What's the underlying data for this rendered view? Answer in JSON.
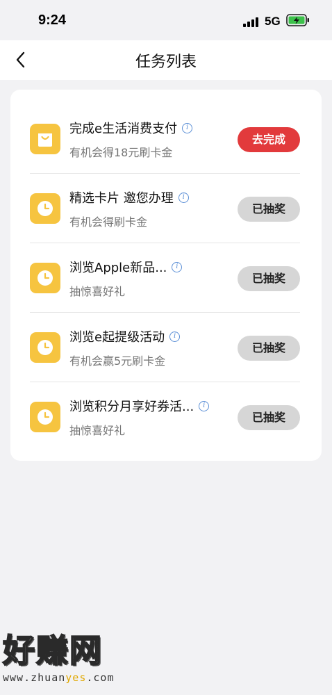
{
  "status_bar": {
    "time": "9:24",
    "network": "5G",
    "signal_icon": "cellular-signal-icon",
    "battery_icon": "battery-charging-icon"
  },
  "nav": {
    "back_icon": "chevron-left-icon",
    "title": "任务列表"
  },
  "tasks": [
    {
      "title": "完成e生活消费支付",
      "subtitle": "有机会得18元刷卡金",
      "button": "去完成",
      "icon": "shopping-bag-icon",
      "state": "active"
    },
    {
      "title": "精选卡片 邀您办理",
      "subtitle": "有机会得刷卡金",
      "button": "已抽奖",
      "icon": "clock-icon",
      "state": "done"
    },
    {
      "title": "浏览Apple新品...",
      "subtitle": "抽惊喜好礼",
      "button": "已抽奖",
      "icon": "clock-icon",
      "state": "done"
    },
    {
      "title": "浏览e起提级活动",
      "subtitle": "有机会赢5元刷卡金",
      "button": "已抽奖",
      "icon": "clock-icon",
      "state": "done"
    },
    {
      "title": "浏览积分月享好券活...",
      "subtitle": "抽惊喜好礼",
      "button": "已抽奖",
      "icon": "clock-icon",
      "state": "done"
    }
  ],
  "info_glyph": "i",
  "watermark": {
    "title": "好赚网",
    "url_prefix": "www.zhuan",
    "url_highlight": "yes",
    "url_suffix": ".com"
  },
  "colors": {
    "accent_red": "#e23a3c",
    "icon_yellow": "#f6c440",
    "info_blue": "#5b8fd6",
    "done_gray": "#d6d6d6",
    "page_bg": "#f2f2f4"
  }
}
